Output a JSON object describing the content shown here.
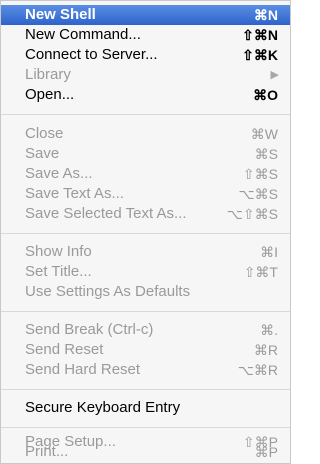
{
  "menu": {
    "items": [
      {
        "label": "New Shell",
        "shortcut": "⌘N",
        "enabled": true,
        "selected": true
      },
      {
        "label": "New Command...",
        "shortcut": "⇧⌘N",
        "enabled": true
      },
      {
        "label": "Connect to Server...",
        "shortcut": "⇧⌘K",
        "enabled": true
      },
      {
        "label": "Library",
        "submenu_icon": "submenu-arrow-icon",
        "enabled": false
      },
      {
        "label": "Open...",
        "shortcut": "⌘O",
        "enabled": true
      },
      {
        "label": "Close",
        "shortcut": "⌘W",
        "enabled": false
      },
      {
        "label": "Save",
        "shortcut": "⌘S",
        "enabled": false
      },
      {
        "label": "Save As...",
        "shortcut": "⇧⌘S",
        "enabled": false
      },
      {
        "label": "Save Text As...",
        "shortcut": "⌥⌘S",
        "enabled": false
      },
      {
        "label": "Save Selected Text As...",
        "shortcut": "⌥⇧⌘S",
        "enabled": false
      },
      {
        "label": "Show Info",
        "shortcut": "⌘I",
        "enabled": false
      },
      {
        "label": "Set Title...",
        "shortcut": "⇧⌘T",
        "enabled": false
      },
      {
        "label": "Use Settings As Defaults",
        "shortcut": "",
        "enabled": false
      },
      {
        "label": "Send Break (Ctrl-c)",
        "shortcut": "⌘.",
        "enabled": false
      },
      {
        "label": "Send Reset",
        "shortcut": "⌘R",
        "enabled": false
      },
      {
        "label": "Send Hard Reset",
        "shortcut": "⌥⌘R",
        "enabled": false
      },
      {
        "label": "Secure Keyboard Entry",
        "shortcut": "",
        "enabled": true
      },
      {
        "label": "Page Setup...",
        "shortcut": "⇧⌘P",
        "enabled": false
      },
      {
        "label": "Print...",
        "shortcut": "⌘P",
        "enabled": false
      }
    ],
    "submenu_arrow_glyph": "▶"
  },
  "colors": {
    "highlight": "#3a6fd6",
    "disabled_text": "#9a9a9a",
    "menu_background": "#f6f6f6"
  }
}
